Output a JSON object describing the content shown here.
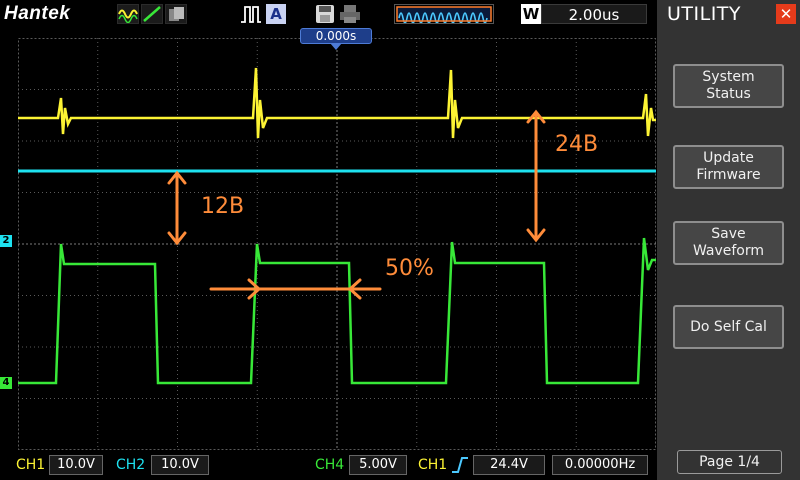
{
  "brand": "Hantek",
  "toolbar": {
    "icons": [
      "waveform-icon",
      "line-icon",
      "overlay-icon",
      "pulse-icon",
      "auto-icon",
      "save-icon",
      "print-icon",
      "memory-waveform-icon"
    ],
    "auto_label": "A",
    "run_stop_label": "W",
    "timebase": "2.00us"
  },
  "screen": {
    "trigger_position": "0.000s",
    "marker_ch2": "2",
    "marker_ch4": "4",
    "annotations": {
      "ch1_amplitude": "24В",
      "ch2_amplitude": "12В",
      "duty_cycle": "50%"
    },
    "colors": {
      "ch1": "#fcf334",
      "ch2": "#1ee2f0",
      "ch4": "#38e838",
      "annotation": "#ff8c3a"
    }
  },
  "panel": {
    "title": "UTILITY",
    "buttons": [
      "System\nStatus",
      "Update\nFirmware",
      "Save\nWaveform",
      "Do Self Cal"
    ],
    "page": "Page 1/4"
  },
  "status": {
    "ch1_label": "CH1",
    "ch1_value": "10.0V",
    "ch2_label": "CH2",
    "ch2_value": "10.0V",
    "ch4_label": "CH4",
    "ch4_value": "5.00V",
    "trig_label": "CH1",
    "trig_level": "24.4V",
    "frequency": "0.00000Hz"
  }
}
